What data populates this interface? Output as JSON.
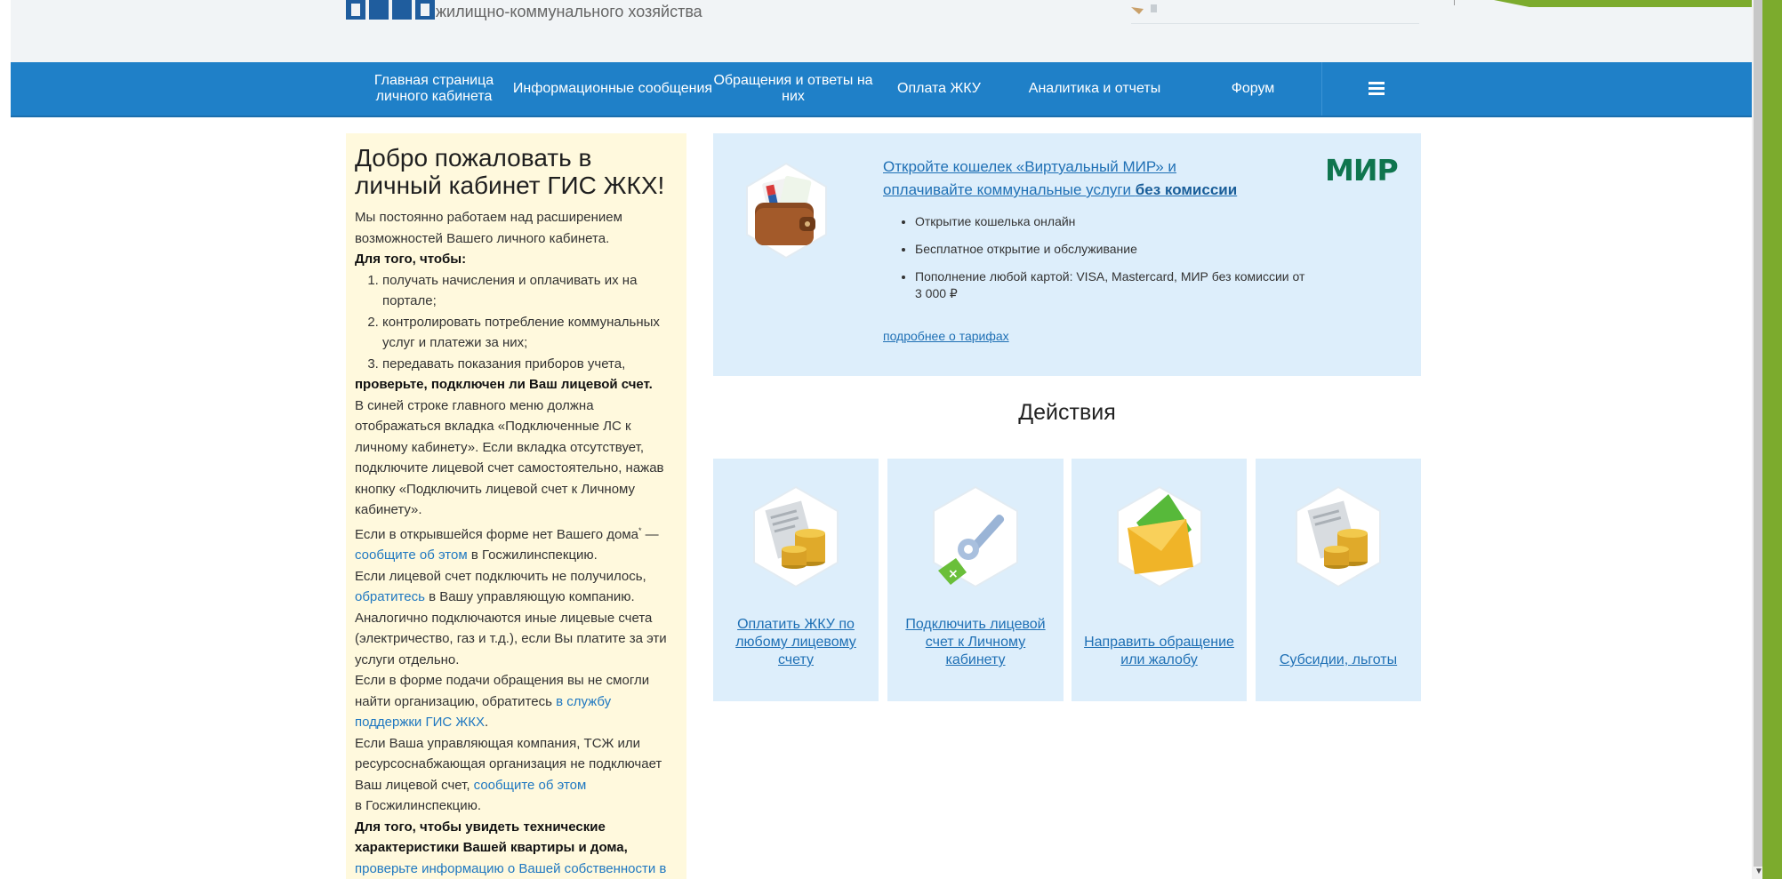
{
  "header": {
    "logo_subtitle": "жилищно-коммунального хозяйства"
  },
  "nav": {
    "items": [
      {
        "label": "Главная страница личного кабинета"
      },
      {
        "label": "Информационные сообщения"
      },
      {
        "label": "Обращения и ответы на них"
      },
      {
        "label": "Оплата ЖКУ"
      },
      {
        "label": "Аналитика и отчеты"
      },
      {
        "label": "Форум"
      }
    ],
    "menu_icon": "hamburger-menu-icon"
  },
  "welcome": {
    "title": "Добро пожаловать в личный кабинет ГИС ЖКХ!",
    "intro": "Мы постоянно работаем над расширением возможностей Вашего личного кабинета.",
    "in_order_to": "Для того, чтобы:",
    "list": [
      "получать начисления и оплачивать их на портале;",
      "контролировать потребление коммунальных услуг и платежи за них;",
      "передавать показания приборов учета,"
    ],
    "check_account": "проверьте, подключен ли Ваш лицевой счет.",
    "p1": "В синей строке главного меню должна отображаться вкладка «Подключенные ЛС к личному кабинету». Если вкладка отсутствует, подключите лицевой счет самостоятельно, нажав кнопку «Подключить лицевой счет к Личному кабинету».",
    "p2_a": "Если в открывшейся форме нет Вашего дома",
    "p2_sup": "*",
    "p2_b": " — ",
    "p2_link": "сообщите об этом",
    "p2_c": " в Госжилинспекцию.",
    "p3_a": "Если лицевой счет подключить не получилось, ",
    "p3_link": "обратитесь",
    "p3_b": " в Вашу управляющую компанию.",
    "p4": "Аналогично подключаются иные лицевые счета (электричество, газ и т.д.), если Вы платите за эти услуги отдельно.",
    "p5_a": "Если в форме подачи обращения вы не смогли найти организацию, обратитесь ",
    "p5_link": "в службу поддержки ГИС ЖКХ",
    "p5_b": ".",
    "p6_a": "Если Ваша управляющая компания, ТСЖ или ресурсоснабжающая организация не подключает Ваш лицевой счет, ",
    "p6_link": "сообщите об этом",
    "p6_b": "в Госжилинспекцию.",
    "p7": "Для того, чтобы увидеть технические характеристики Вашей квартиры и дома,",
    "p7_link": "проверьте информацию о Вашей собственности в ГИС ЖКХ"
  },
  "promo": {
    "title_a": "Откройте кошелек «Виртуальный МИР» и оплачивайте коммунальные услуги ",
    "title_b": "без комиссии",
    "bullets": [
      "Открытие кошелька онлайн",
      "Бесплатное открытие и обслуживание",
      "Пополнение любой картой: VISA, Mastercard, МИР без комиссии от 3 000 ₽"
    ],
    "more_link": "подробнее о тарифах",
    "brand": "МИР"
  },
  "actions": {
    "title": "Действия",
    "cards": [
      {
        "label": "Оплатить ЖКУ по любому лицевому счету",
        "icon": "invoice-coins-icon"
      },
      {
        "label": "Подключить лицевой счет к Личному кабинету",
        "icon": "key-tag-icon"
      },
      {
        "label": "Направить обращение или жалобу",
        "icon": "envelope-icon"
      },
      {
        "label": "Субсидии, льготы",
        "icon": "subsidy-coins-icon"
      }
    ]
  },
  "colors": {
    "nav_blue": "#1f80c8",
    "panel_yellow": "#fff9dd",
    "panel_blue": "#ddeefb",
    "link": "#1f70b5",
    "brand_green": "#0f754e"
  }
}
